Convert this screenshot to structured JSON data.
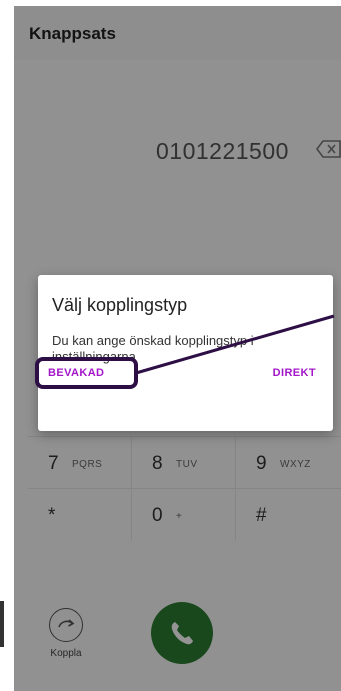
{
  "app": {
    "title": "Knappsats"
  },
  "display": {
    "number": "0101221500",
    "backspace_icon": "backspace-icon"
  },
  "keypad": {
    "rows": [
      [
        {
          "digit": "7",
          "letters": "PQRS"
        },
        {
          "digit": "8",
          "letters": "TUV"
        },
        {
          "digit": "9",
          "letters": "WXYZ"
        }
      ],
      [
        {
          "digit": "*",
          "letters": ""
        },
        {
          "digit": "0",
          "letters": "+"
        },
        {
          "digit": "#",
          "letters": ""
        }
      ]
    ]
  },
  "bottom": {
    "koppla_label": "Koppla"
  },
  "dialog": {
    "title": "Välj kopplingstyp",
    "message": "Du kan ange önskad kopplingstyp i inställningarna",
    "button_left": "BEVAKAD",
    "button_right": "DIREKT"
  },
  "colors": {
    "accent": "#a317c9",
    "call": "#2e7d32",
    "annotation": "#2d0f45"
  }
}
